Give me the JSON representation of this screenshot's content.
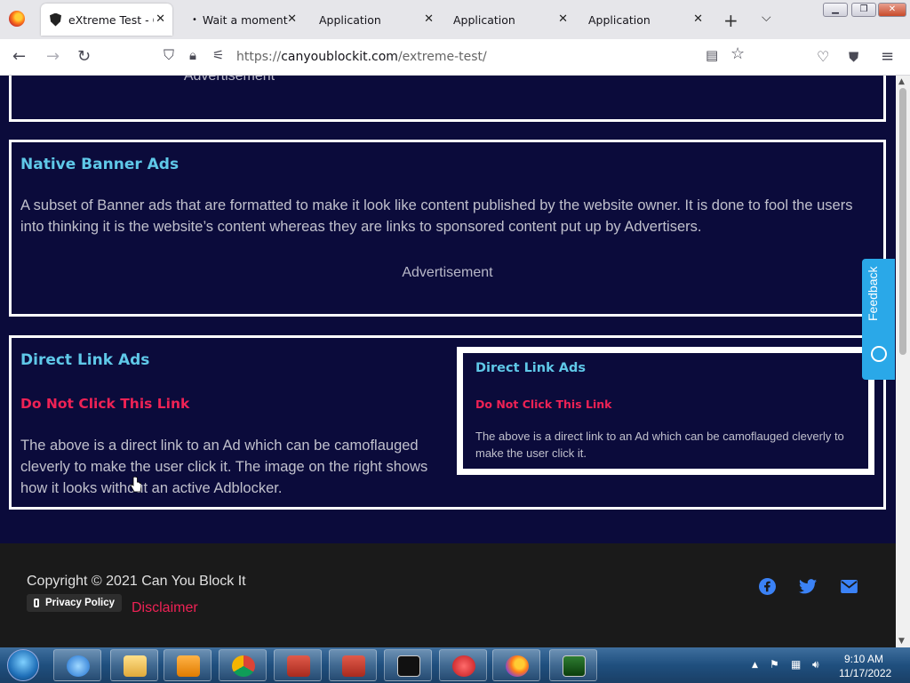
{
  "browser": {
    "tabs": [
      {
        "title": "eXtreme Test - Ca",
        "active": true
      },
      {
        "title": "Wait a moment, l",
        "active": false
      },
      {
        "title": "Application",
        "active": false
      },
      {
        "title": "Application",
        "active": false
      },
      {
        "title": "Application",
        "active": false
      }
    ],
    "url_prefix": "https://",
    "url_host": "canyoublockit.com",
    "url_path": "/extreme-test/"
  },
  "page": {
    "top_advertisement": "Advertisement",
    "native_banner": {
      "title": "Native Banner Ads",
      "text": "A subset of Banner ads that are formatted to make it look like content published by the website owner. It is done to fool the users into thinking it is the website’s content whereas they are links to sponsored content put up by Advertisers.",
      "advertisement": "Advertisement"
    },
    "direct_link": {
      "title": "Direct Link Ads",
      "link_text": "Do Not Click This Link",
      "text": "The above is a direct link to an Ad which can be camoflauged cleverly to make the user click it. The image on the right shows how it looks without an active Adblocker.",
      "preview": {
        "title": "Direct Link Ads",
        "link_text": "Do Not Click This Link",
        "text": "The above is a direct link to an Ad which can be camoflauged cleverly to make the user click it."
      }
    },
    "feedback_label": "Feedback",
    "footer": {
      "copyright": "Copyright © 2021 Can You Block It",
      "privacy_policy": "Privacy Policy",
      "disclaimer": "Disclaimer"
    }
  },
  "taskbar": {
    "time": "9:10 AM",
    "date": "11/17/2022"
  },
  "colors": {
    "page_bg": "#0b0b3b",
    "section_title": "#5fc8e8",
    "danger_link": "#ee2255",
    "feedback_tab": "#2aa8e8",
    "footer_bg": "#1a1a1a",
    "social_icons": "#3b82f6"
  },
  "icons": {
    "tab_icon": "shield-icon",
    "navigation": [
      "back-arrow-icon",
      "forward-arrow-icon",
      "reload-icon"
    ],
    "url_bar": [
      "tracking-shield-icon",
      "lock-icon",
      "permissions-icon",
      "reader-view-icon",
      "bookmark-star-icon"
    ],
    "toolbar": [
      "pocket-icon",
      "extension-icon",
      "menu-icon"
    ],
    "social": [
      "facebook-icon",
      "twitter-icon",
      "email-icon"
    ]
  }
}
